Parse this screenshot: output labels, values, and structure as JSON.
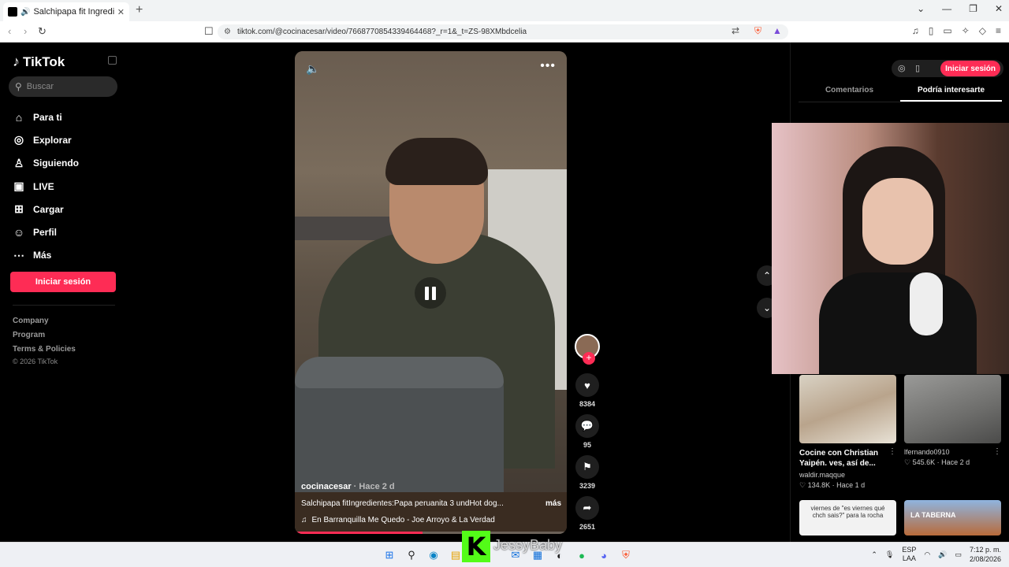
{
  "browser": {
    "tab_title": "Salchipapa fit Ingredientes:P",
    "new_tab": "+",
    "url": "tiktok.com/@cocinacesar/video/7668770854339464468?_r=1&_t=ZS-98XMbdcelia"
  },
  "sidebar": {
    "logo_text": "TikTok",
    "search_placeholder": "Buscar",
    "items": [
      {
        "label": "Para ti",
        "icon": "home-icon"
      },
      {
        "label": "Explorar",
        "icon": "compass-icon"
      },
      {
        "label": "Siguiendo",
        "icon": "user-follow-icon"
      },
      {
        "label": "LIVE",
        "icon": "live-icon"
      },
      {
        "label": "Cargar",
        "icon": "upload-icon"
      },
      {
        "label": "Perfil",
        "icon": "profile-icon"
      },
      {
        "label": "Más",
        "icon": "more-icon"
      }
    ],
    "login_label": "Iniciar sesión",
    "footer": [
      "Company",
      "Program",
      "Terms & Policies"
    ],
    "copyright": "© 2026 TikTok"
  },
  "video": {
    "author": "cocinacesar",
    "when": "· Hace 2 d",
    "description": "Salchipapa fitIngredientes:Papa peruanita 3 undHot dog...",
    "more": "más",
    "music": "En Barranquilla Me Quedo - Joe Arroyo & La Verdad",
    "progress": 0.47
  },
  "actions": {
    "likes": "8384",
    "comments": "95",
    "saves": "3239",
    "shares": "2651"
  },
  "right_panel": {
    "login_label": "Iniciar sesión",
    "tabs": [
      "Comentarios",
      "Podría interesarte"
    ],
    "cards": [
      {
        "title": "Cocine con Christian Yaipén. ves, así de...",
        "user": "waldir.maqque",
        "stats": "♡ 134.8K · Hace 1 d"
      },
      {
        "title": "",
        "user": "lfernando0910",
        "stats": "♡ 545.6K · Hace 2 d"
      }
    ],
    "thumb3_text": "viernes de \"es viernes qué chch sais?\" para la rocha",
    "thumb4_text": "LA TABERNA"
  },
  "overlay": {
    "kick_letter": "K",
    "streamer": "JessyBaby"
  },
  "taskbar": {
    "lang": "ESP",
    "lang2": "LAA",
    "time": "7:12 p. m.",
    "date": "2/08/2026"
  },
  "colors": {
    "accent": "#fe2c55",
    "kick_green": "#53fc18"
  }
}
